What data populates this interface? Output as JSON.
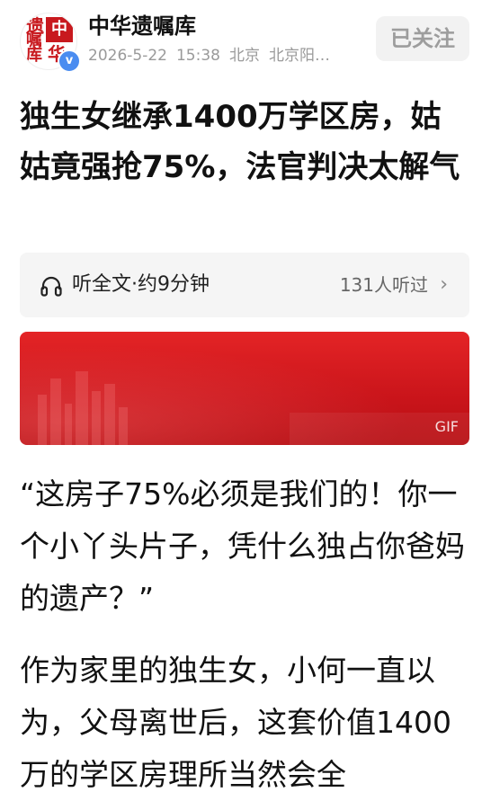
{
  "header": {
    "account_name": "中华遗嘱库",
    "date": "2026-5-22",
    "time": "15:38",
    "location": "北京",
    "location_detail": "北京阳…",
    "follow_label": "已关注",
    "avatar_seal": {
      "c1": "遗",
      "c2": "中",
      "c3": "嘱",
      "c4": "库",
      "c5": "华"
    }
  },
  "article": {
    "title": "独生女继承1400万学区房，姑姑竟强抢75%，法官判决太解气",
    "listen_label": "听全文·约9分钟",
    "listen_count": "131人听过",
    "banner_tag": "GIF",
    "paragraphs": [
      "“这房子75%必须是我们的！你一个小丫头片子，凭什么独占你爸妈的遗产？”",
      "作为家里的独生女，小何一直以为，父母离世后，这套价值1400万的学区房理所当然会全"
    ]
  },
  "icons": {
    "verified": "verified-icon",
    "headphone": "headphone-icon",
    "chevron": "chevron-right-icon"
  },
  "colors": {
    "brand_red": "#c8191e",
    "banner_red": "#e42426",
    "verified_blue": "#4a8cf0",
    "muted_text": "#9a9a9a"
  }
}
